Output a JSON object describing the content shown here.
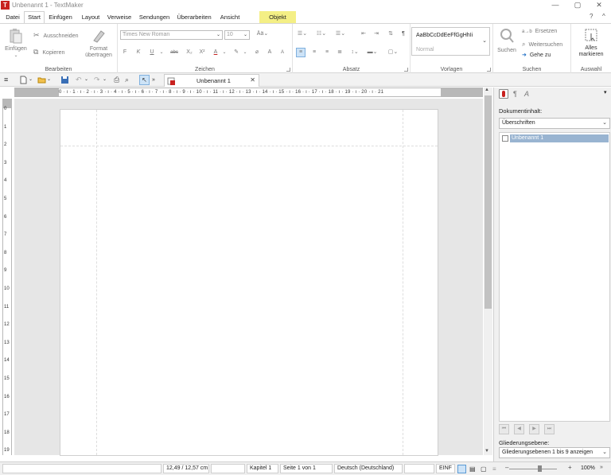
{
  "window": {
    "title": "Unbenannt 1 - TextMaker",
    "app_icon": "T",
    "min": "—",
    "max": "▢",
    "close": "✕"
  },
  "menu": {
    "items": [
      "Datei",
      "Start",
      "Einfügen",
      "Layout",
      "Verweise",
      "Sendungen",
      "Überarbeiten",
      "Ansicht",
      "Objekt"
    ],
    "active": "Start",
    "help": "?",
    "collapse": "^"
  },
  "ribbon": {
    "bearbeiten": {
      "label": "Bearbeiten",
      "einfuegen": "Einfügen",
      "ausschneiden": "Ausschneiden",
      "kopieren": "Kopieren",
      "format_line1": "Format",
      "format_line2": "übertragen"
    },
    "zeichen": {
      "label": "Zeichen",
      "font": "Times New Roman",
      "size": "10",
      "f": "F",
      "k": "K",
      "u": "U",
      "abc": "abc",
      "sub": "X₂",
      "sup": "X²",
      "a_color": "A",
      "a_grow": "A",
      "a_shrink": "A"
    },
    "absatz": {
      "label": "Absatz",
      "pilcrow": "¶"
    },
    "vorlagen": {
      "label": "Vorlagen",
      "preview": "AaBbCcDdEeFfGgHhIi",
      "normal": "Normal"
    },
    "suchen": {
      "label": "Suchen",
      "suchen": "Suchen",
      "ersetzen": "Ersetzen",
      "weitersuchen": "Weitersuchen",
      "gehe_zu": "Gehe zu"
    },
    "auswahl": {
      "label": "Auswahl",
      "line1": "Alles",
      "line2": "markieren"
    }
  },
  "doc_tab": {
    "label": "Unbenannt 1",
    "close": "✕"
  },
  "ruler": {
    "h_numbers": "0 · ı · 1 · ı · 2 · ı · 3 · ı · 4 · ı · 5 · ı · 6 · ı · 7 · ı · 8 · ı · 9 · ı · 10 · ı · 11 · ı · 12 · ı · 13 · ı · 14 · ı · 15 · ı · 16 · ı · 17 · ı · 18 · ı · 19 · ı · 20 · ı · 21",
    "v_numbers": [
      "0",
      "1",
      "2",
      "3",
      "4",
      "5",
      "6",
      "7",
      "8",
      "9",
      "10",
      "11",
      "12",
      "13",
      "14",
      "15",
      "16",
      "17",
      "18",
      "19"
    ]
  },
  "sidebar": {
    "dokumentinhalt_label": "Dokumentinhalt:",
    "filter": "Überschriften",
    "item": "Unbenannt 1",
    "gliederung_label": "Gliederungsebene:",
    "gliederung_value": "Gliederungsebenen 1 bis 9 anzeigen"
  },
  "status": {
    "position": "12,49 / 12,57 cm",
    "kapitel": "Kapitel 1",
    "seite": "Seite 1 von 1",
    "sprache": "Deutsch (Deutschland)",
    "modus": "EINF",
    "zoom": "100%",
    "zoom_minus": "–",
    "zoom_plus": "+"
  },
  "colors": {
    "accent": "#c8211f",
    "selection": "#99b4d1",
    "objekt_tab": "#f4ef85"
  }
}
